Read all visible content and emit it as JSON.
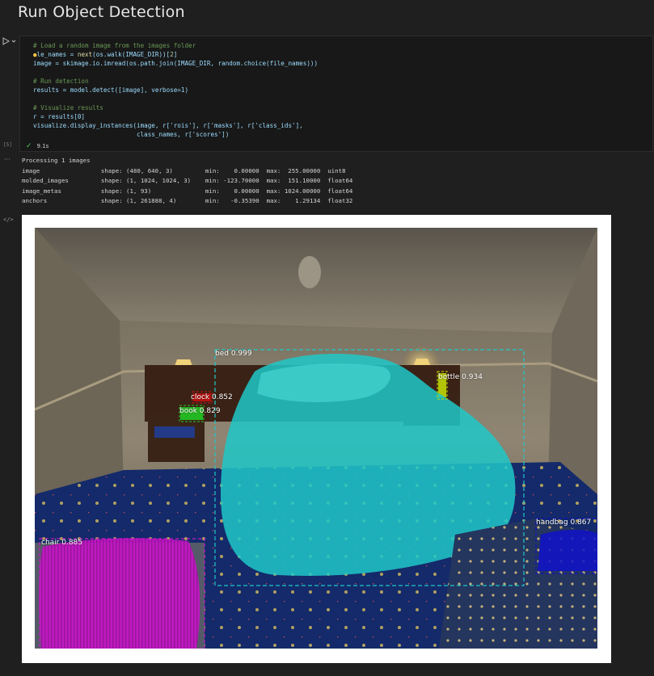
{
  "heading": "Run Object Detection",
  "cell": {
    "execution_count": "[5]",
    "duration": "9.1s",
    "code_lines": {
      "c1": "# Load a random image from the images folder",
      "l1a": "le_names = ",
      "l1b": "next",
      "l1c": "(os.walk(IMAGE_DIR))[",
      "l1d": "2",
      "l1e": "]",
      "l2": "image = skimage.io.imread(os.path.join(IMAGE_DIR, random.choice(file_names)))",
      "c2": "# Run detection",
      "l3": "results = model.detect([image], verbose=1)",
      "c3": "# Visualize results",
      "l4": "r = results[0]",
      "l5": "visualize.display_instances(image, r['rois'], r['masks'], r['class_ids'],",
      "l6": "                            class_names, r['scores'])"
    }
  },
  "output": {
    "processing": "Processing 1 images",
    "rows": [
      "image                 shape: (480, 640, 3)         min:    0.00000  max:  255.00000  uint8",
      "molded_images         shape: (1, 1024, 1024, 3)    min: -123.70000  max:  151.10000  float64",
      "image_metas           shape: (1, 93)               min:    0.00000  max: 1024.00000  float64",
      "anchors               shape: (1, 261888, 4)        min:   -0.35390  max:    1.29134  float32"
    ]
  },
  "detections": [
    {
      "label": "bed 0.999",
      "color": "#1fc8c8"
    },
    {
      "label": "bottle 0.934",
      "color": "#c8e000"
    },
    {
      "label": "clock 0.852",
      "color": "#d01010"
    },
    {
      "label": "book 0.829",
      "color": "#22c822"
    },
    {
      "label": "handbag 0.867",
      "color": "#1010c8"
    },
    {
      "label": "chair 0.885",
      "color": "#c818c8"
    }
  ]
}
